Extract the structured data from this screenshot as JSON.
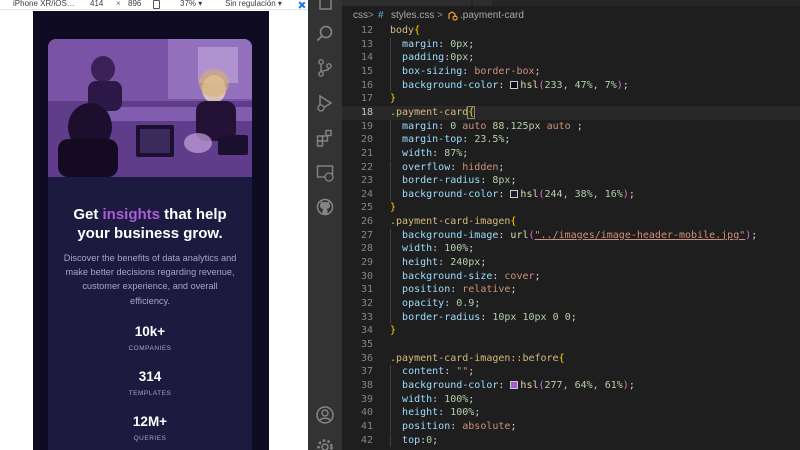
{
  "devtools": {
    "device": "iPhone XR/iOS…",
    "width": "414",
    "x": "×",
    "height": "896",
    "zoom": "37% ▾",
    "throttle": "Sin regulación ▾"
  },
  "card": {
    "title_pre": "Get ",
    "title_accent": "insights",
    "title_post": " that help your business grow.",
    "description": "Discover the benefits of data analytics and make better decisions regarding revenue, customer experience, and overall efficiency.",
    "stats": [
      {
        "value": "10k+",
        "label": "COMPANIES"
      },
      {
        "value": "314",
        "label": "TEMPLATES"
      },
      {
        "value": "12M+",
        "label": "QUERIES"
      }
    ],
    "colors": {
      "background": "#0e0b22",
      "card": "#1c1a3f",
      "accent": "#ab5cdb",
      "overlay": "#7b53a6"
    }
  },
  "activitybar": {
    "icons": [
      "files-icon",
      "search-icon",
      "source-control-icon",
      "run-debug-icon",
      "extensions-icon",
      "remote-explorer-icon",
      "github-icon",
      "account-icon",
      "settings-gear-icon"
    ]
  },
  "breadcrumb": {
    "folder": "css",
    "sep": ">",
    "file_icon": "#",
    "file": "styles.css",
    "symbol": ".payment-card"
  },
  "code_lines": [
    {
      "n": "12",
      "t": "body{"
    },
    {
      "n": "13",
      "t": "  margin: 0px;"
    },
    {
      "n": "14",
      "t": "  padding:0px;"
    },
    {
      "n": "15",
      "t": "  box-sizing: border-box;"
    },
    {
      "n": "16",
      "t": "  background-color: hsl(233, 47%, 7%);"
    },
    {
      "n": "17",
      "t": "}"
    },
    {
      "n": "18",
      "t": ".payment-card{"
    },
    {
      "n": "19",
      "t": "  margin: 0 auto 88.125px auto ;"
    },
    {
      "n": "20",
      "t": "  margin-top: 23.5%;"
    },
    {
      "n": "21",
      "t": "  width: 87%;"
    },
    {
      "n": "22",
      "t": "  overflow: hidden;"
    },
    {
      "n": "23",
      "t": "  border-radius: 8px;"
    },
    {
      "n": "24",
      "t": "  background-color: hsl(244, 38%, 16%);"
    },
    {
      "n": "25",
      "t": "}"
    },
    {
      "n": "26",
      "t": ".payment-card-imagen{"
    },
    {
      "n": "27",
      "t": "  background-image: url(\"../images/image-header-mobile.jpg\");"
    },
    {
      "n": "28",
      "t": "  width: 100%;"
    },
    {
      "n": "29",
      "t": "  height: 240px;"
    },
    {
      "n": "30",
      "t": "  background-size: cover;"
    },
    {
      "n": "31",
      "t": "  position: relative;"
    },
    {
      "n": "32",
      "t": "  opacity: 0.9;"
    },
    {
      "n": "33",
      "t": "  border-radius: 10px 10px 0 0;"
    },
    {
      "n": "34",
      "t": "}"
    },
    {
      "n": "35",
      "t": ""
    },
    {
      "n": "36",
      "t": ".payment-card-imagen::before{"
    },
    {
      "n": "37",
      "t": "  content: \"\";"
    },
    {
      "n": "38",
      "t": "  background-color: hsl(277, 64%, 61%);"
    },
    {
      "n": "39",
      "t": "  width: 100%;"
    },
    {
      "n": "40",
      "t": "  height: 100%;"
    },
    {
      "n": "41",
      "t": "  position: absolute;"
    },
    {
      "n": "42",
      "t": "  top:0;"
    }
  ],
  "active_line": "18",
  "swatches": {
    "16": "#0b0c1a",
    "24": "#1d1a38",
    "38": "#a65bd4"
  }
}
